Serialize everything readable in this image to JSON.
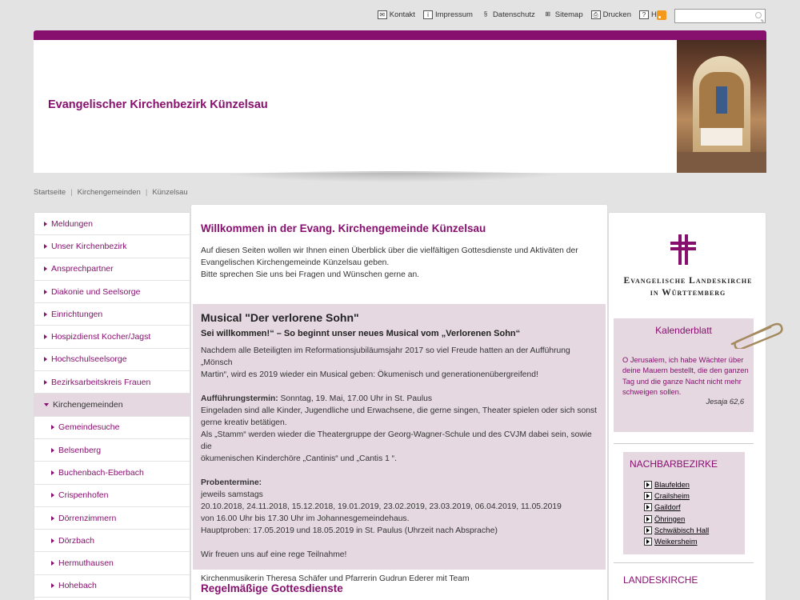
{
  "toplinks": [
    {
      "icon": "mail-icon",
      "glyph": "✉",
      "label": "Kontakt"
    },
    {
      "icon": "info-icon",
      "glyph": "i",
      "label": "Impressum"
    },
    {
      "icon": "paragraph-icon",
      "glyph": "§",
      "label": "Datenschutz"
    },
    {
      "icon": "sitemap-icon",
      "glyph": "⊞",
      "label": "Sitemap"
    },
    {
      "icon": "printer-icon",
      "glyph": "⎙",
      "label": "Drucken"
    },
    {
      "icon": "help-icon",
      "glyph": "?",
      "label": "Hilfe"
    }
  ],
  "search": {
    "placeholder": "",
    "value": ""
  },
  "header": {
    "title": "Evangelischer Kirchenbezirk Künzelsau"
  },
  "breadcrumb": [
    "Startseite",
    "Kirchengemeinden",
    "Künzelsau"
  ],
  "nav": [
    {
      "label": "Meldungen",
      "level": 0
    },
    {
      "label": "Unser Kirchenbezirk",
      "level": 0
    },
    {
      "label": "Ansprechpartner",
      "level": 0
    },
    {
      "label": "Diakonie und Seelsorge",
      "level": 0
    },
    {
      "label": "Einrichtungen",
      "level": 0
    },
    {
      "label": "Hospizdienst Kocher/Jagst",
      "level": 0
    },
    {
      "label": "Hochschulseelsorge",
      "level": 0
    },
    {
      "label": "Bezirksarbeitskreis Frauen",
      "level": 0
    },
    {
      "label": "Kirchengemeinden",
      "level": 0,
      "active": true
    },
    {
      "label": "Gemeindesuche",
      "level": 1
    },
    {
      "label": "Belsenberg",
      "level": 1
    },
    {
      "label": "Buchenbach-Eberbach",
      "level": 1
    },
    {
      "label": "Crispenhofen",
      "level": 1
    },
    {
      "label": "Dörrenzimmern",
      "level": 1
    },
    {
      "label": "Dörzbach",
      "level": 1
    },
    {
      "label": "Hermuthausen",
      "level": 1
    },
    {
      "label": "Hohebach",
      "level": 1
    }
  ],
  "main": {
    "welcome_title": "Willkommen in der Evang. Kirchengemeinde Künzelsau",
    "welcome_line1": "Auf diesen Seiten wollen wir Ihnen einen Überblick über die vielfältigen Gottesdienste und Aktiväten der",
    "welcome_line2": "Evangelischen Kirchengemeinde Künzelsau geben.",
    "welcome_line3": "Bitte sprechen Sie uns bei Fragen und Wünschen gerne an.",
    "musical": {
      "title": "Musical \"Der verlorene Sohn\"",
      "subtitle": "Sei willkommen!“ – So beginnt unser neues Musical vom „Verlorenen Sohn“",
      "intro1": "Nachdem alle Beteiligten im Reformationsjubiläumsjahr 2017 so viel Freude hatten an der Aufführung „Mönsch",
      "intro2": "Martin“, wird es 2019 wieder ein Musical geben: Ökumenisch und generationenübergreifend!",
      "termin_label": "Aufführungstermin:",
      "termin_value": " Sonntag, 19. Mai, 17.00 Uhr in St. Paulus",
      "invite1": "Eingeladen sind alle Kinder, Jugendliche und Erwachsene, die gerne singen, Theater spielen oder sich sonst",
      "invite2": "gerne kreativ betätigen.",
      "stamm1": "Als „Stamm“ werden wieder die Theatergruppe der Georg-Wagner-Schule und des CVJM dabei sein, sowie die",
      "stamm2": "ökumenischen Kinderchöre „Cantinis“ und „Cantis 1 “.",
      "probe_label": "Probentermine:",
      "probe1": "jeweils samstags",
      "probe2": "20.10.2018, 24.11.2018, 15.12.2018, 19.01.2019, 23.02.2019, 23.03.2019, 06.04.2019, 11.05.2019",
      "probe3": "von 16.00 Uhr bis 17.30 Uhr im Johannesgemeindehaus.",
      "probe4": "Hauptproben: 17.05.2019 und 18.05.2019 in St. Paulus (Uhrzeit nach Absprache)",
      "closing": "Wir freuen uns auf eine rege Teilnahme!",
      "signature": "Kirchenmusikerin Theresa Schäfer und Pfarrerin Gudrun Ederer mit Team"
    },
    "regel_title": "Regelmäßige Gottesdienste"
  },
  "right": {
    "logo_line1": "Evangelische Landeskirche",
    "logo_line2": "in Württemberg",
    "kalender_title": "Kalenderblatt",
    "kalender_text": "O Jerusalem, ich habe Wächter über deine Mauern bestellt, die den ganzen Tag und die ganze Nacht nicht mehr schweigen sollen.",
    "kalender_source": "Jesaja 62,6",
    "nachbar_title": "NACHBARBEZIRKE",
    "nachbar_items": [
      "Blaufelden",
      "Crailsheim",
      "Gaildorf",
      "Öhringen",
      "Schwäbisch Hall",
      "Weikersheim"
    ],
    "landes_title": "LANDESKIRCHE"
  },
  "colors": {
    "brand": "#87106f",
    "box": "#e5d8e0",
    "background": "#e4e3e3"
  }
}
